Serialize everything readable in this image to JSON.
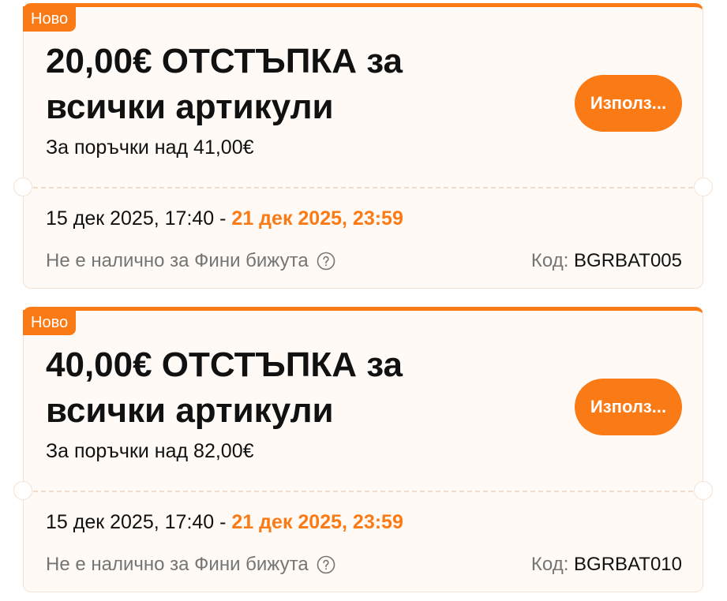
{
  "coupons": [
    {
      "badge": "Ново",
      "title": "20,00€ ОТСТЪПКА за всички артикули",
      "min_order": "За поръчки над 41,00€",
      "use_button": "Използ...",
      "valid_from": "15 дек 2025, 17:40 - ",
      "valid_to": "21 дек 2025, 23:59",
      "note": "Не е налично за Фини бижута",
      "code_label": "Код: ",
      "code_value": "BGRBAT005"
    },
    {
      "badge": "Ново",
      "title": "40,00€ ОТСТЪПКА за всички артикули",
      "min_order": "За поръчки над 82,00€",
      "use_button": "Използ...",
      "valid_from": "15 дек 2025, 17:40 - ",
      "valid_to": "21 дек 2025, 23:59",
      "note": "Не е налично за Фини бижута",
      "code_label": "Код: ",
      "code_value": "BGRBAT010"
    }
  ],
  "icons": {
    "help": "question-circle-icon"
  },
  "colors": {
    "accent": "#fa7a16",
    "card_bg": "#fffaf5",
    "muted_text": "#757575",
    "main_text": "#111111"
  }
}
